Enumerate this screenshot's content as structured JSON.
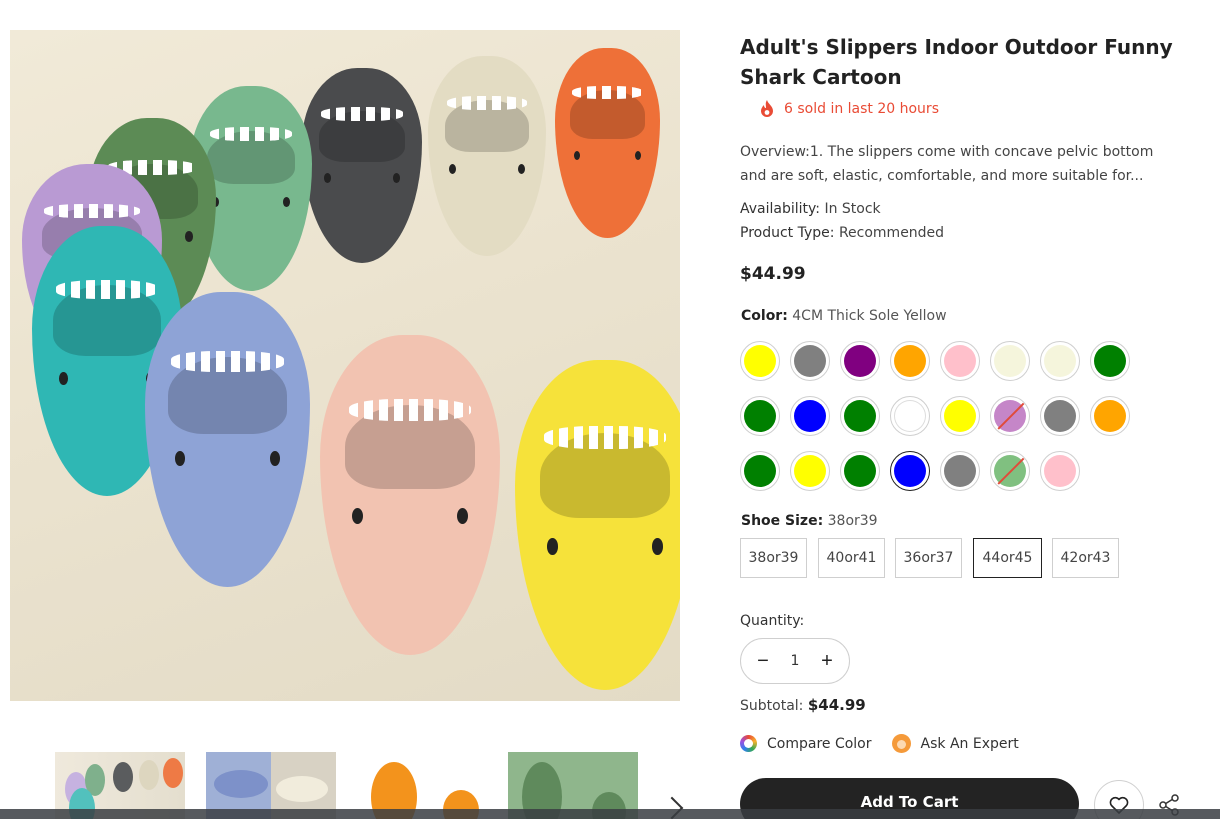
{
  "product": {
    "title": "Adult's Slippers Indoor Outdoor Funny Shark Cartoon",
    "sold_text": "6 sold in last 20 hours",
    "overview": "Overview:1. The slippers come with concave pelvic bottom and are soft, elastic, comfortable, and more suitable for...",
    "availability_label": "Availability:",
    "availability_value": "In Stock",
    "type_label": "Product Type:",
    "type_value": "Recommended",
    "price": "$44.99"
  },
  "color_option": {
    "label": "Color:",
    "value": "4CM Thick Sole Yellow",
    "swatches": [
      {
        "color": "#ffff00",
        "selected": false,
        "sold_out": false
      },
      {
        "color": "#808080",
        "selected": false,
        "sold_out": false
      },
      {
        "color": "#800080",
        "selected": false,
        "sold_out": false
      },
      {
        "color": "#ffa500",
        "selected": false,
        "sold_out": false
      },
      {
        "color": "#ffc0cb",
        "selected": false,
        "sold_out": false
      },
      {
        "color": "#f5f5dc",
        "selected": false,
        "sold_out": false
      },
      {
        "color": "#f5f5dc",
        "selected": false,
        "sold_out": false
      },
      {
        "color": "#008000",
        "selected": false,
        "sold_out": false
      },
      {
        "color": "#008000",
        "selected": false,
        "sold_out": false
      },
      {
        "color": "#0000ff",
        "selected": false,
        "sold_out": false
      },
      {
        "color": "#008000",
        "selected": false,
        "sold_out": false
      },
      {
        "color": "#ffffff",
        "selected": false,
        "sold_out": false
      },
      {
        "color": "#ffff00",
        "selected": false,
        "sold_out": false
      },
      {
        "color": "#c586c8",
        "selected": false,
        "sold_out": true
      },
      {
        "color": "#808080",
        "selected": false,
        "sold_out": false
      },
      {
        "color": "#ffa500",
        "selected": false,
        "sold_out": false
      },
      {
        "color": "#008000",
        "selected": false,
        "sold_out": false
      },
      {
        "color": "#ffff00",
        "selected": false,
        "sold_out": false
      },
      {
        "color": "#008000",
        "selected": false,
        "sold_out": false
      },
      {
        "color": "#0000ff",
        "selected": true,
        "sold_out": false
      },
      {
        "color": "#808080",
        "selected": false,
        "sold_out": false
      },
      {
        "color": "#80c080",
        "selected": false,
        "sold_out": true
      },
      {
        "color": "#ffc0cb",
        "selected": false,
        "sold_out": false
      }
    ]
  },
  "size_option": {
    "label": "Shoe Size:",
    "value": "38or39",
    "sizes": [
      {
        "label": "38or39",
        "selected": false
      },
      {
        "label": "40or41",
        "selected": false
      },
      {
        "label": "36or37",
        "selected": false
      },
      {
        "label": "44or45",
        "selected": true
      },
      {
        "label": "42or43",
        "selected": false
      }
    ]
  },
  "quantity": {
    "label": "Quantity:",
    "value": "1",
    "minus": "−",
    "plus": "+"
  },
  "subtotal": {
    "label": "Subtotal:",
    "value": "$44.99"
  },
  "links": {
    "compare": "Compare Color",
    "expert": "Ask An Expert"
  },
  "actions": {
    "add_to_cart": "Add To Cart"
  },
  "icons": {
    "sold": "fire-icon",
    "compare": "color-wheel-icon",
    "expert": "expert-avatar-icon",
    "wishlist": "heart-icon",
    "share": "share-icon",
    "thumb_next": "chevron-right-icon"
  },
  "colors": {
    "accent_red": "#e94b35",
    "button_dark": "#232323"
  }
}
